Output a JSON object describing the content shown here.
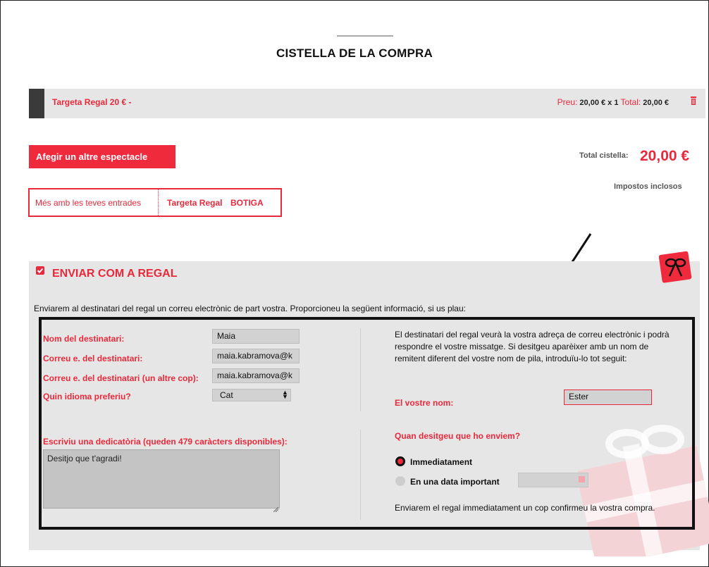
{
  "page": {
    "title": "CISTELLA DE LA COMPRA"
  },
  "cart": {
    "item_name": "Targeta Regal 20 € -",
    "price_label": "Preu:",
    "price_value": "20,00 € x 1",
    "total_label": "Total:",
    "total_value": "20,00 €",
    "delete_icon": "trash-icon"
  },
  "actions": {
    "add_show_label": "Afegir un altre espectacle"
  },
  "totals": {
    "label": "Total cistella:",
    "value": "20,00 €",
    "tax_note": "Impostos inclosos"
  },
  "tabs": [
    {
      "label": "Més amb les teves entrades"
    },
    {
      "label": "Targeta Regal"
    },
    {
      "label": "BOTIGA"
    }
  ],
  "gift": {
    "heading": "ENVIAR COM A REGAL",
    "checked": true,
    "intro": "Enviarem al destinatari del regal un correu electrònic de part vostra. Proporcioneu la següent informació, si us plau:",
    "fields": {
      "recipient_name": {
        "label": "Nom del destinatari:",
        "value": "Maia"
      },
      "recipient_email": {
        "label": "Correu e. del destinatari:",
        "value": "maia.kabramova@k"
      },
      "recipient_email_confirm": {
        "label": "Correu e. del destinatari (un altre cop):",
        "value": "maia.kabramova@k"
      },
      "language": {
        "label": "Quin idioma preferiu?",
        "value": "Cat"
      }
    },
    "sender_info": "El destinatari del regal veurà la vostra adreça de correu electrònic i podrà respondre el vostre missatge. Si desitgeu aparèixer amb un nom de remitent diferent del vostre nom de pila, introduïu-lo tot seguit:",
    "sender_name_label": "El vostre nom:",
    "sender_name_value": "Ester",
    "dedication_label": "Escriviu una dedicatòria (queden 479 caràcters disponibles):",
    "dedication_value": "Desitjo que t'agradi!",
    "when_label": "Quan desitgeu que ho enviem?",
    "option_now": "Immediatament",
    "option_date": "En una data important",
    "selected_option": "Immediatament",
    "footer_note": "Enviarem el regal immediatament un cop confirmeu la vostra compra."
  },
  "colors": {
    "accent": "#e8293b",
    "panel": "#e6e6e6",
    "field": "#d2d2d2"
  }
}
